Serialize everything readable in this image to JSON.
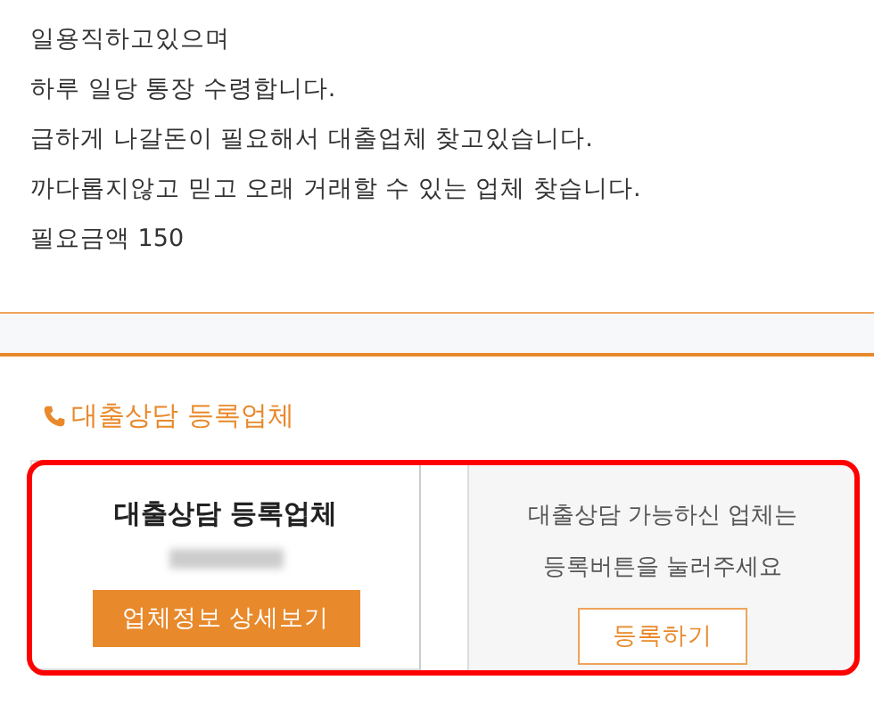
{
  "post": {
    "lines": [
      "일용직하고있으며",
      "하루 일당 통장 수령합니다.",
      "급하게 나갈돈이 필요해서 대출업체 찾고있습니다.",
      "까다롭지않고 믿고 오래 거래할 수 있는 업체 찾습니다.",
      "필요금액 150"
    ]
  },
  "section": {
    "title": "대출상담 등록업체"
  },
  "lenders": {
    "registered": {
      "title": "대출상담 등록업체",
      "button": "업체정보 상세보기"
    },
    "register": {
      "message_lines": [
        "대출상담 가능하신 업체는",
        "등록버튼을 눌러주세요"
      ],
      "button": "등록하기"
    }
  }
}
